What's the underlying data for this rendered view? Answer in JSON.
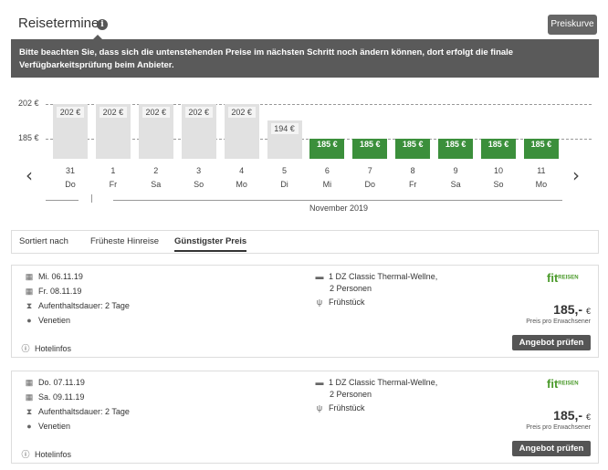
{
  "header": {
    "title": "Reisetermine",
    "info_icon": "info-icon",
    "preiskurve_label": "Preiskurve"
  },
  "tooltip": {
    "text": "Bitte beachten Sie, dass sich die untenstehenden Preise im nächsten Schritt noch ändern können, dort erfolgt die finale Verfügbarkeitsprüfung beim Anbieter."
  },
  "chart_data": {
    "type": "bar",
    "categories": [
      "31 Do",
      "1 Fr",
      "2 Sa",
      "3 So",
      "4 Mo",
      "5 Di",
      "6 Mi",
      "7 Do",
      "8 Fr",
      "9 Sa",
      "10 So",
      "11 Mo"
    ],
    "days": [
      {
        "num": "31",
        "name": "Do",
        "value": 202,
        "label": "202 €",
        "cheapest": false
      },
      {
        "num": "1",
        "name": "Fr",
        "value": 202,
        "label": "202 €",
        "cheapest": false
      },
      {
        "num": "2",
        "name": "Sa",
        "value": 202,
        "label": "202 €",
        "cheapest": false
      },
      {
        "num": "3",
        "name": "So",
        "value": 202,
        "label": "202 €",
        "cheapest": false
      },
      {
        "num": "4",
        "name": "Mo",
        "value": 202,
        "label": "202 €",
        "cheapest": false
      },
      {
        "num": "5",
        "name": "Di",
        "value": 194,
        "label": "194 €",
        "cheapest": false
      },
      {
        "num": "6",
        "name": "Mi",
        "value": 185,
        "label": "185 €",
        "cheapest": true
      },
      {
        "num": "7",
        "name": "Do",
        "value": 185,
        "label": "185 €",
        "cheapest": true
      },
      {
        "num": "8",
        "name": "Fr",
        "value": 185,
        "label": "185 €",
        "cheapest": true
      },
      {
        "num": "9",
        "name": "Sa",
        "value": 185,
        "label": "185 €",
        "cheapest": true
      },
      {
        "num": "10",
        "name": "So",
        "value": 185,
        "label": "185 €",
        "cheapest": true
      },
      {
        "num": "11",
        "name": "Mo",
        "value": 185,
        "label": "185 €",
        "cheapest": true
      }
    ],
    "y_ticks": [
      {
        "value": 202,
        "label": "202 €"
      },
      {
        "value": 185,
        "label": "185 €"
      }
    ],
    "ylim": [
      175,
      202
    ],
    "month_label": "November 2019",
    "colors": {
      "cheapest": "#3b8f3b",
      "regular": "#e1e1e1"
    }
  },
  "sort": {
    "label": "Sortiert nach",
    "options": [
      "Früheste Hinreise",
      "Günstigster Preis"
    ],
    "active": "Günstigster Preis"
  },
  "offers": [
    {
      "outbound": "Mi. 06.11.19",
      "return": "Fr. 08.11.19",
      "duration": "Aufenthaltsdauer: 2 Tage",
      "region": "Venetien",
      "room_line1": "1 DZ Classic Thermal-Wellne,",
      "room_line2": "2 Personen",
      "board": "Frühstück",
      "operator_main": "fit",
      "operator_sub": "REISEN",
      "price": "185,-",
      "currency": "€",
      "price_note": "Preis pro Erwachsener",
      "button": "Angebot prüfen",
      "hotel_info": "Hotelinfos"
    },
    {
      "outbound": "Do. 07.11.19",
      "return": "Sa. 09.11.19",
      "duration": "Aufenthaltsdauer: 2 Tage",
      "region": "Venetien",
      "room_line1": "1 DZ Classic Thermal-Wellne,",
      "room_line2": "2 Personen",
      "board": "Frühstück",
      "operator_main": "fit",
      "operator_sub": "REISEN",
      "price": "185,-",
      "currency": "€",
      "price_note": "Preis pro Erwachsener",
      "button": "Angebot prüfen",
      "hotel_info": "Hotelinfos"
    }
  ]
}
